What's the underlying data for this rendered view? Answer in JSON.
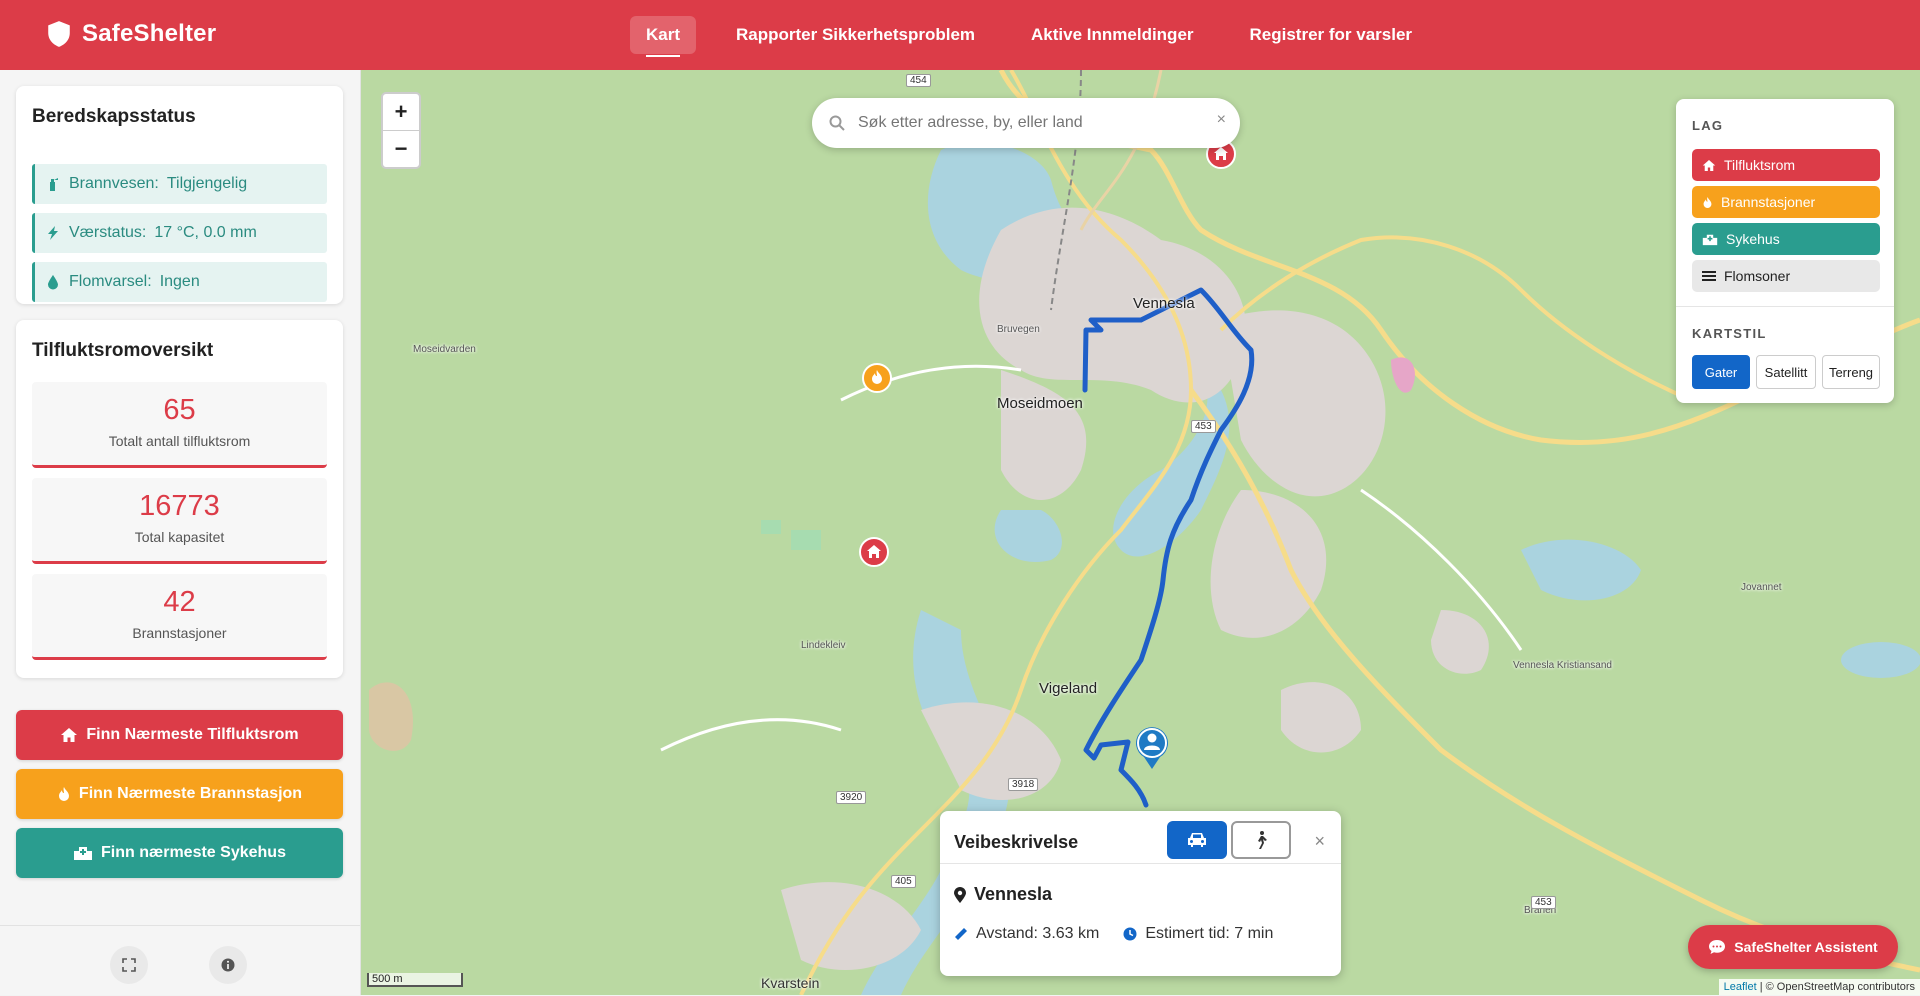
{
  "app": {
    "name": "SafeShelter",
    "nav": [
      {
        "label": "Kart",
        "active": true
      },
      {
        "label": "Rapporter Sikkerhetsproblem",
        "active": false
      },
      {
        "label": "Aktive Innmeldinger",
        "active": false
      },
      {
        "label": "Registrer for varsler",
        "active": false
      }
    ]
  },
  "colors": {
    "brand_red": "#dc3c48",
    "orange": "#f7a11c",
    "teal": "#2a9d8f",
    "blue": "#1266c8"
  },
  "preparedness": {
    "title": "Beredskapsstatus",
    "items": [
      {
        "icon": "fire-extinguisher-icon",
        "label": "Brannvesen:",
        "value": "Tilgjengelig"
      },
      {
        "icon": "bolt-icon",
        "label": "Værstatus:",
        "value": "17 °C, 0.0 mm"
      },
      {
        "icon": "water-drop-icon",
        "label": "Flomvarsel:",
        "value": "Ingen"
      }
    ]
  },
  "overview": {
    "title": "Tilfluktsromoversikt",
    "stats": [
      {
        "value": "65",
        "label": "Totalt antall tilfluktsrom"
      },
      {
        "value": "16773",
        "label": "Total kapasitet"
      },
      {
        "value": "42",
        "label": "Brannstasjoner"
      }
    ]
  },
  "actions": {
    "shelter": "Finn Nærmeste Tilfluktsrom",
    "fire": "Finn Nærmeste Brannstasjon",
    "hospital": "Finn nærmeste Sykehus"
  },
  "footer_icons": [
    "fullscreen-icon",
    "info-icon"
  ],
  "map": {
    "zoom_in": "+",
    "zoom_out": "−",
    "search_placeholder": "Søk etter adresse, by, eller land",
    "search_clear": "×",
    "labels": {
      "vennesla": "Vennesla",
      "moseidmoen": "Moseidmoen",
      "vigeland": "Vigeland",
      "kvarstein": "Kvarstein",
      "lindekleiv": "Lindekleiv",
      "moseidvarden": "Moseidvarden",
      "branen": "Brånen",
      "jovannet": "Jovannet",
      "vennesla_kristiansand": "Vennesla Kristiansand",
      "bruvegen": "Bruvegen",
      "road_454": "454",
      "road_405": "405",
      "road_3918": "3918",
      "road_3920": "3920",
      "road_453": "453",
      "road_453b": "453"
    },
    "scale": "500 m",
    "attribution_leaflet": "Leaflet",
    "attribution_osm": "| © OpenStreetMap contributors"
  },
  "layers": {
    "title": "LAG",
    "items": [
      {
        "label": "Tilfluktsrom",
        "icon": "home-icon"
      },
      {
        "label": "Brannstasjoner",
        "icon": "fire-icon"
      },
      {
        "label": "Sykehus",
        "icon": "hospital-icon"
      },
      {
        "label": "Flomsoner",
        "icon": "waves-icon"
      }
    ],
    "style_title": "KARTSTIL",
    "styles": [
      {
        "label": "Gater",
        "active": true
      },
      {
        "label": "Satellitt",
        "active": false
      },
      {
        "label": "Terreng",
        "active": false
      }
    ]
  },
  "route": {
    "title": "Veibeskrivelse",
    "mode": "car",
    "close": "×",
    "destination": "Vennesla",
    "distance": "Avstand: 3.63 km",
    "time": "Estimert tid: 7 min"
  },
  "assistant": "SafeShelter Assistent"
}
